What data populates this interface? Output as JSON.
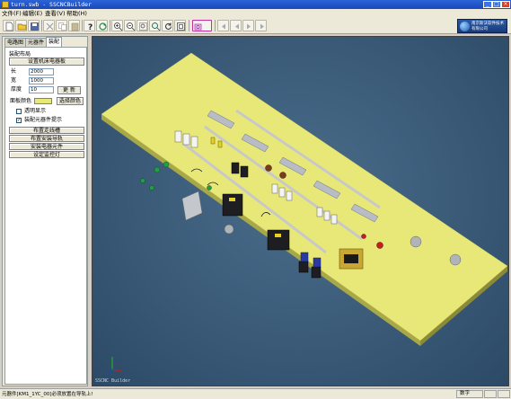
{
  "window": {
    "title": "turn.swb - SSCNCBuilder",
    "minimize": "_",
    "maximize": "□",
    "close": "×"
  },
  "menu": {
    "items": [
      "文件(F)",
      "编辑(E)",
      "查看(V)",
      "帮助(H)"
    ]
  },
  "toolbar": {
    "icons": [
      "new-file-icon",
      "open-folder-icon",
      "save-icon",
      "delete-icon",
      "cut-icon",
      "copy-icon",
      "paste-icon",
      "help-icon",
      "refresh-icon",
      "zoom-in-icon",
      "zoom-out-icon",
      "zoom-window-icon",
      "zoom-fit-icon",
      "rotate-icon",
      "grid-icon",
      "camera-icon",
      "back-icon",
      "prev-icon",
      "next-icon",
      "forward-icon"
    ],
    "logo_text": "南京斯沃软件技术有限公司"
  },
  "left_panel": {
    "tabs": [
      "电路图",
      "元器件",
      "装配"
    ],
    "active_tab": "装配",
    "group_title": "装配布局",
    "set_board_button": "设置机床电器板",
    "length_label": "长",
    "length_value": "2000",
    "width_label": "宽",
    "width_value": "1000",
    "thickness_label": "厚度",
    "thickness_value": "10",
    "update_button": "更 新",
    "board_color_label": "面板颜色",
    "board_color": "#e8e878",
    "choose_color_button": "选择颜色",
    "transparent_label": "透明显示",
    "transparent_checked": false,
    "hint_label": "装配元器件提示",
    "hint_checked": true,
    "layout_buttons": [
      "布置走线槽",
      "布置安装导轨",
      "安装电器元件",
      "设定监控灯"
    ]
  },
  "canvas": {
    "watermark": "SSCNC Builder",
    "board_color": "#e8e878",
    "background": "#3a5a78"
  },
  "statusbar": {
    "message": "元器件[KM1_1YC_00]必须放置在导轨上!",
    "mode": "数字"
  }
}
